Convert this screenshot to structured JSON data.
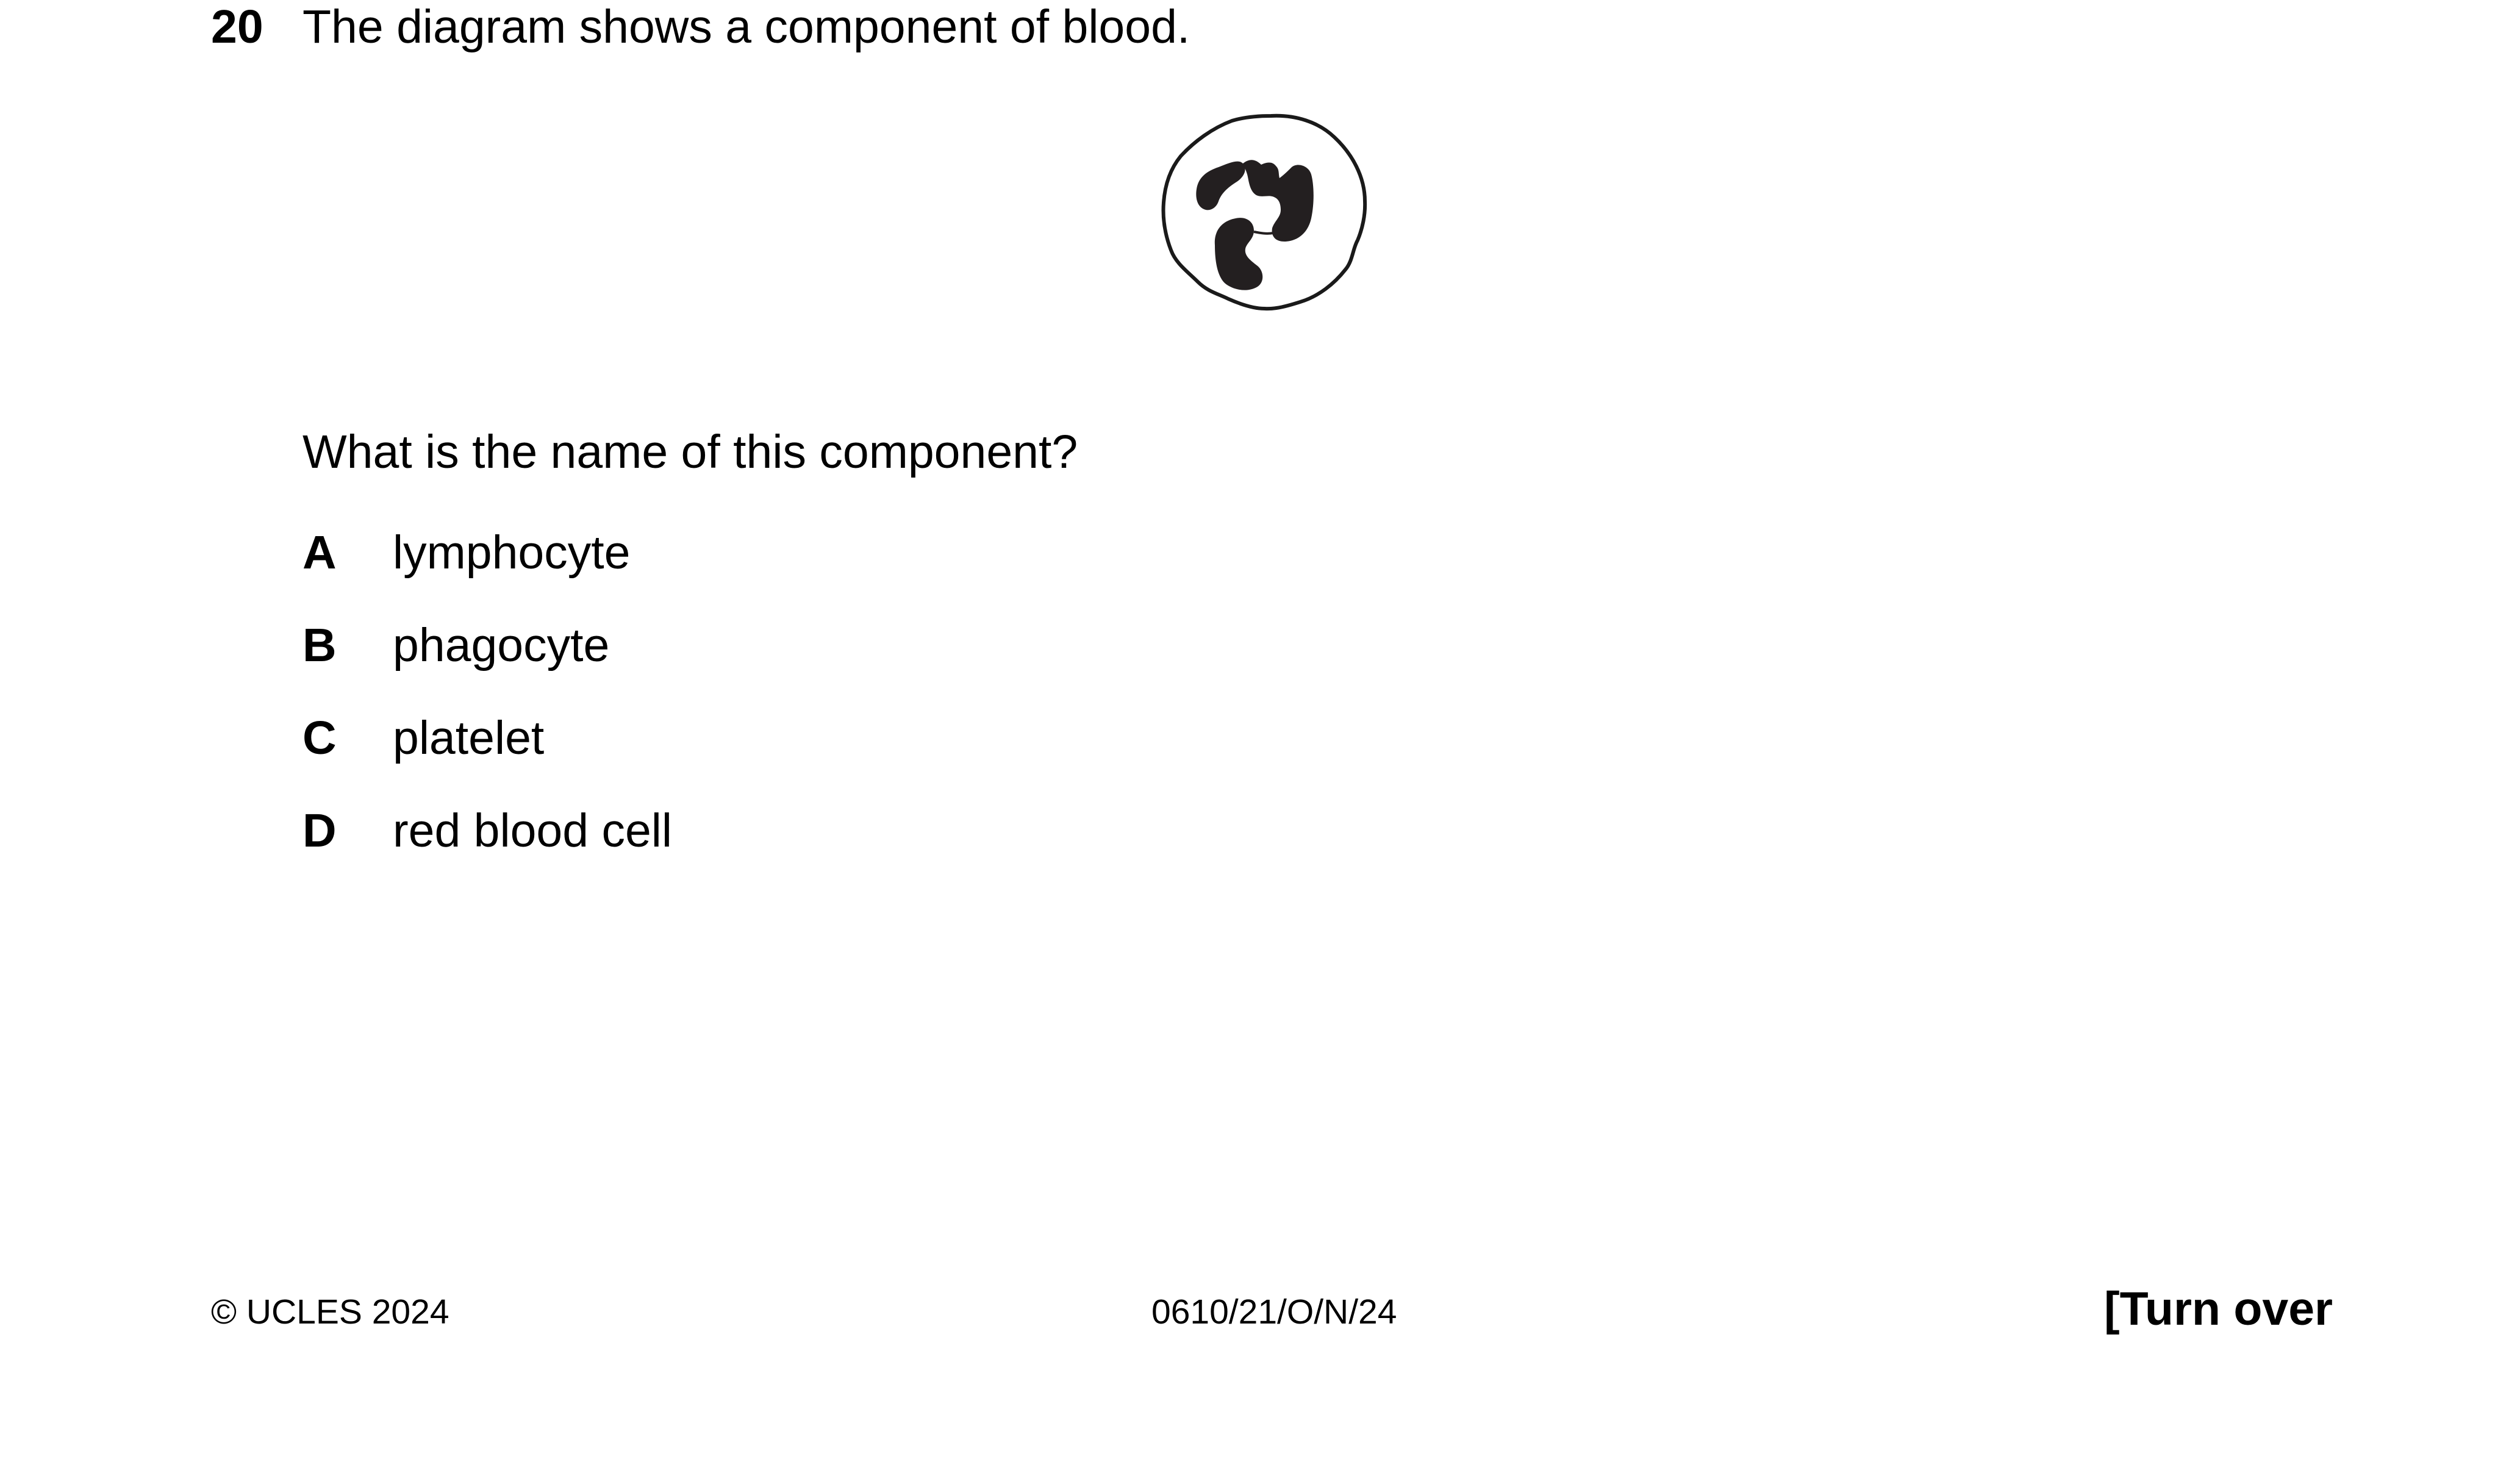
{
  "question": {
    "number": "20",
    "stem": "The diagram shows a component of blood.",
    "prompt": "What is the name of this component?",
    "options": [
      {
        "letter": "A",
        "text": "lymphocyte"
      },
      {
        "letter": "B",
        "text": "phagocyte"
      },
      {
        "letter": "C",
        "text": "platelet"
      },
      {
        "letter": "D",
        "text": "red blood cell"
      }
    ]
  },
  "figure": {
    "icon": "white-blood-cell-diagram",
    "outline_color": "#1a1a1a",
    "nucleus_color": "#231f20"
  },
  "footer": {
    "copyright": "© UCLES 2024",
    "paper_code": "0610/21/O/N/24",
    "turn_over": "[Turn over"
  }
}
